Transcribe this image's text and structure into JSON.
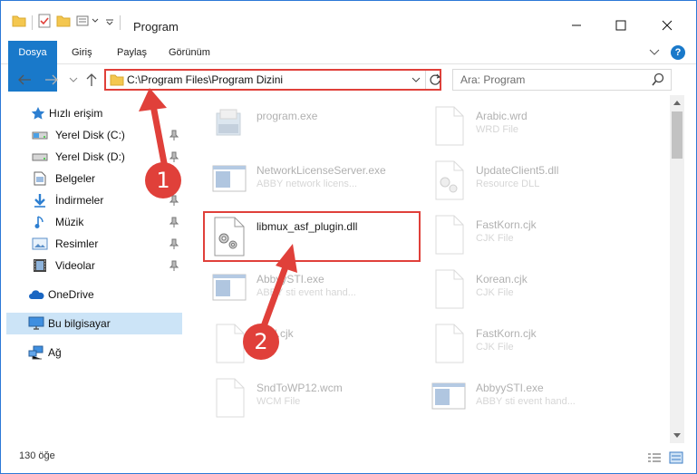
{
  "window": {
    "title": "Program"
  },
  "ribbon": {
    "tabs": [
      "Dosya",
      "Giriş",
      "Paylaş",
      "Görünüm"
    ],
    "help": "?"
  },
  "address": {
    "path": "C:\\Program Files\\Program Dizini"
  },
  "search": {
    "placeholder": "Ara: Program"
  },
  "sidebar": {
    "items": [
      {
        "label": "Hızlı erişim",
        "icon": "star-icon",
        "pinned": false
      },
      {
        "label": "Yerel Disk (C:)",
        "icon": "drive-icon",
        "pinned": true
      },
      {
        "label": "Yerel Disk (D:)",
        "icon": "drive-icon",
        "pinned": true
      },
      {
        "label": "Belgeler",
        "icon": "documents-icon",
        "pinned": true
      },
      {
        "label": "İndirmeler",
        "icon": "download-icon",
        "pinned": true
      },
      {
        "label": "Müzik",
        "icon": "music-icon",
        "pinned": true
      },
      {
        "label": "Resimler",
        "icon": "pictures-icon",
        "pinned": true
      },
      {
        "label": "Videolar",
        "icon": "video-icon",
        "pinned": true
      },
      {
        "label": "OneDrive",
        "icon": "cloud-icon",
        "pinned": false
      },
      {
        "label": "Bu bilgisayar",
        "icon": "computer-icon",
        "pinned": false,
        "selected": true
      },
      {
        "label": "Ağ",
        "icon": "network-icon",
        "pinned": false
      }
    ]
  },
  "files": [
    {
      "name": "program.exe",
      "desc": "",
      "icon": "installer-icon"
    },
    {
      "name": "Arabic.wrd",
      "desc": "WRD File",
      "icon": "document-icon"
    },
    {
      "name": "NetworkLicenseServer.exe",
      "desc": "ABBY network licens...",
      "icon": "app-window-icon"
    },
    {
      "name": "UpdateClient5.dll",
      "desc": "Resource DLL",
      "icon": "dll-gear-icon"
    },
    {
      "name": "libmux_asf_plugin.dll",
      "desc": "",
      "icon": "dll-gear-icon"
    },
    {
      "name": "FastKorn.cjk",
      "desc": "CJK File",
      "icon": "document-icon"
    },
    {
      "name": "AbbyySTI.exe",
      "desc": "ABBY sti event hand...",
      "icon": "app-window-icon"
    },
    {
      "name": "Korean.cjk",
      "desc": "CJK File",
      "icon": "document-icon"
    },
    {
      "name": "html.cjk",
      "desc": "",
      "icon": "document-icon"
    },
    {
      "name": "FastKorn.cjk",
      "desc": "CJK File",
      "icon": "document-icon"
    },
    {
      "name": "SndToWP12.wcm",
      "desc": "WCM File",
      "icon": "document-icon"
    },
    {
      "name": "AbbyySTI.exe",
      "desc": "ABBY sti event hand...",
      "icon": "app-window-icon"
    }
  ],
  "status": {
    "count": "130 öğe"
  },
  "annotations": {
    "step1": "1",
    "step2": "2",
    "color": "#e0403a"
  }
}
